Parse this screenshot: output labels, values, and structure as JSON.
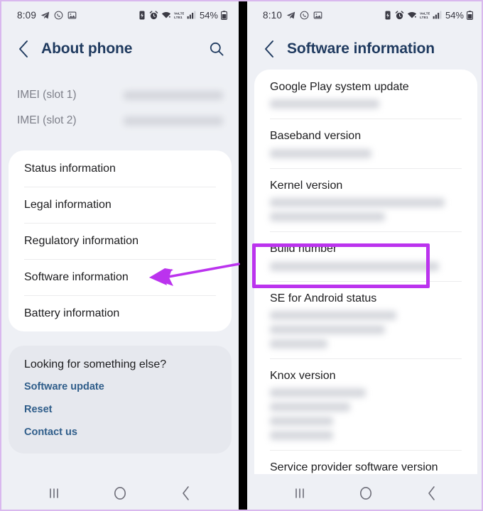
{
  "meta": {
    "accent_purple": "#bb33ee",
    "title_blue": "#1f3a5f",
    "link_blue": "#2f5d8a",
    "panel_bg": "#eef0f5",
    "card_bg": "#ffffff"
  },
  "left_phone": {
    "status_bar": {
      "time": "8:09",
      "battery_percent": "54%",
      "left_icons": [
        "telegram-icon",
        "whatsapp-icon",
        "gallery-icon"
      ],
      "right_icons": [
        "battery-saver-icon",
        "alarm-icon",
        "wifi-icon",
        "volte-icon",
        "signal-icon",
        "battery-icon"
      ]
    },
    "app_bar": {
      "back_icon": "chevron-left-icon",
      "title": "About phone",
      "search_icon": "search-icon"
    },
    "imei": [
      {
        "label": "IMEI (slot 1)",
        "value_hidden": true
      },
      {
        "label": "IMEI (slot 2)",
        "value_hidden": true
      }
    ],
    "menu_items": [
      {
        "label": "Status information"
      },
      {
        "label": "Legal information"
      },
      {
        "label": "Regulatory information"
      },
      {
        "label": "Software information"
      },
      {
        "label": "Battery information"
      }
    ],
    "looking_for": {
      "title": "Looking for something else?",
      "links": [
        {
          "label": "Software update"
        },
        {
          "label": "Reset"
        },
        {
          "label": "Contact us"
        }
      ]
    },
    "nav_bar": {
      "recents_icon": "recents-icon",
      "home_icon": "home-icon",
      "back_icon": "back-icon"
    }
  },
  "right_phone": {
    "status_bar": {
      "time": "8:10",
      "battery_percent": "54%",
      "left_icons": [
        "telegram-icon",
        "whatsapp-icon",
        "gallery-icon"
      ],
      "right_icons": [
        "battery-saver-icon",
        "alarm-icon",
        "wifi-icon",
        "volte-icon",
        "signal-icon",
        "battery-icon"
      ]
    },
    "app_bar": {
      "back_icon": "chevron-left-icon",
      "title": "Software information"
    },
    "info_rows": [
      {
        "label": "Google Play system update",
        "blur_lines": 1,
        "blur_widths": [
          "57%"
        ]
      },
      {
        "label": "Baseband version",
        "blur_lines": 1,
        "blur_widths": [
          "53%"
        ]
      },
      {
        "label": "Kernel version",
        "blur_lines": 2,
        "blur_widths": [
          "91%",
          "60%"
        ]
      },
      {
        "label": "Build number",
        "blur_lines": 1,
        "blur_widths": [
          "88%"
        ],
        "highlighted": true
      },
      {
        "label": "SE for Android status",
        "blur_lines": 3,
        "blur_widths": [
          "66%",
          "60%",
          "30%"
        ]
      },
      {
        "label": "Knox version",
        "blur_lines": 4,
        "blur_widths": [
          "50%",
          "42%",
          "33%",
          "33%"
        ]
      },
      {
        "label": "Service provider software version",
        "blur_lines": 1,
        "blur_widths": [
          "80%"
        ]
      }
    ],
    "nav_bar": {
      "recents_icon": "recents-icon",
      "home_icon": "home-icon",
      "back_icon": "back-icon"
    }
  },
  "annotations": {
    "arrow": {
      "name": "pointer-arrow",
      "color": "#bb33ee",
      "points_to": "Software information"
    },
    "highlight": {
      "name": "highlight-rectangle",
      "color": "#bb33ee",
      "surrounds": "Build number"
    }
  }
}
